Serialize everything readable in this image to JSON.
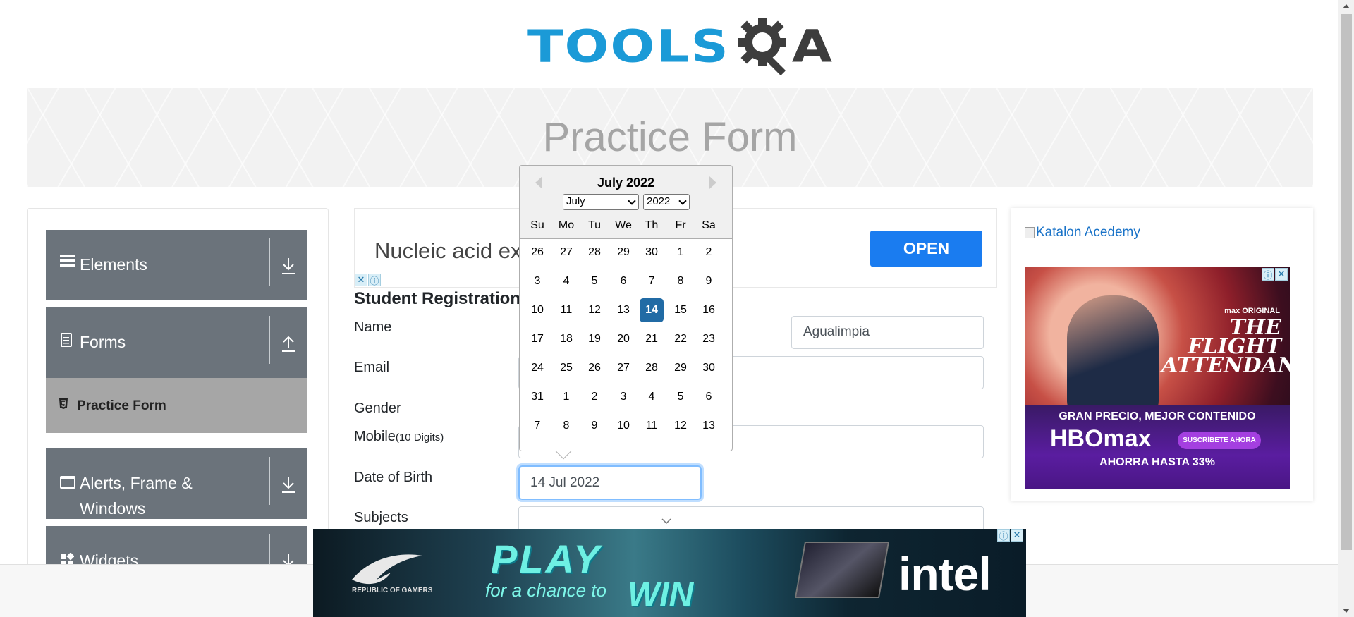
{
  "logo": {
    "tools": "TOOLS",
    "qa": "A"
  },
  "banner": {
    "title": "Practice Form"
  },
  "sidebar": {
    "groups": [
      {
        "label": "Elements",
        "icon": "hamburger-icon"
      },
      {
        "label": "Forms",
        "icon": "document-icon"
      },
      {
        "label": "Alerts, Frame &",
        "label2": "Windows",
        "icon": "window-icon"
      },
      {
        "label": "Widgets",
        "icon": "widgets-icon"
      }
    ],
    "active_item": "Practice Form"
  },
  "top_ad": {
    "text": "Nucleic acid ex",
    "button": "OPEN"
  },
  "form": {
    "title": "Student Registration",
    "name_label": "Name",
    "last_name_value": "Agualimpia",
    "email_label": "Email",
    "gender_label": "Gender",
    "mobile_label": "Mobile",
    "mobile_hint": "(10 Digits)",
    "dob_label": "Date of Birth",
    "dob_value": "14 Jul 2022",
    "subjects_label": "Subjects"
  },
  "datepicker": {
    "title": "July 2022",
    "month_select": "July",
    "year_select": "2022",
    "weekdays": [
      "Su",
      "Mo",
      "Tu",
      "We",
      "Th",
      "Fr",
      "Sa"
    ],
    "weeks": [
      [
        "26",
        "27",
        "28",
        "29",
        "30",
        "1",
        "2"
      ],
      [
        "3",
        "4",
        "5",
        "6",
        "7",
        "8",
        "9"
      ],
      [
        "10",
        "11",
        "12",
        "13",
        "14",
        "15",
        "16"
      ],
      [
        "17",
        "18",
        "19",
        "20",
        "21",
        "22",
        "23"
      ],
      [
        "24",
        "25",
        "26",
        "27",
        "28",
        "29",
        "30"
      ],
      [
        "31",
        "1",
        "2",
        "3",
        "4",
        "5",
        "6"
      ],
      [
        "7",
        "8",
        "9",
        "10",
        "11",
        "12",
        "13"
      ]
    ],
    "selected_day": "14",
    "selected_color": "#216ba5"
  },
  "right_ad": {
    "broken_image_alt": "Katalon Acedemy",
    "brand_small": "max ORIGINAL",
    "show_title": "THE FLIGHT ATTENDANT",
    "line1": "GRAN PRECIO, MEJOR CONTENIDO",
    "logo": "HBOmax",
    "cta": "SUSCRÍBETE AHORA",
    "line2": "AHORRA HASTA 33%"
  },
  "bottom_ad": {
    "brand": "REPUBLIC OF GAMERS",
    "play": "PLAY",
    "for_a_chance": "for a chance to",
    "win": "WIN",
    "intel": "intel"
  },
  "colors": {
    "accent": "#1b9ad7",
    "sidebar_group": "#6b737b",
    "open_button": "#1a7cf0"
  }
}
